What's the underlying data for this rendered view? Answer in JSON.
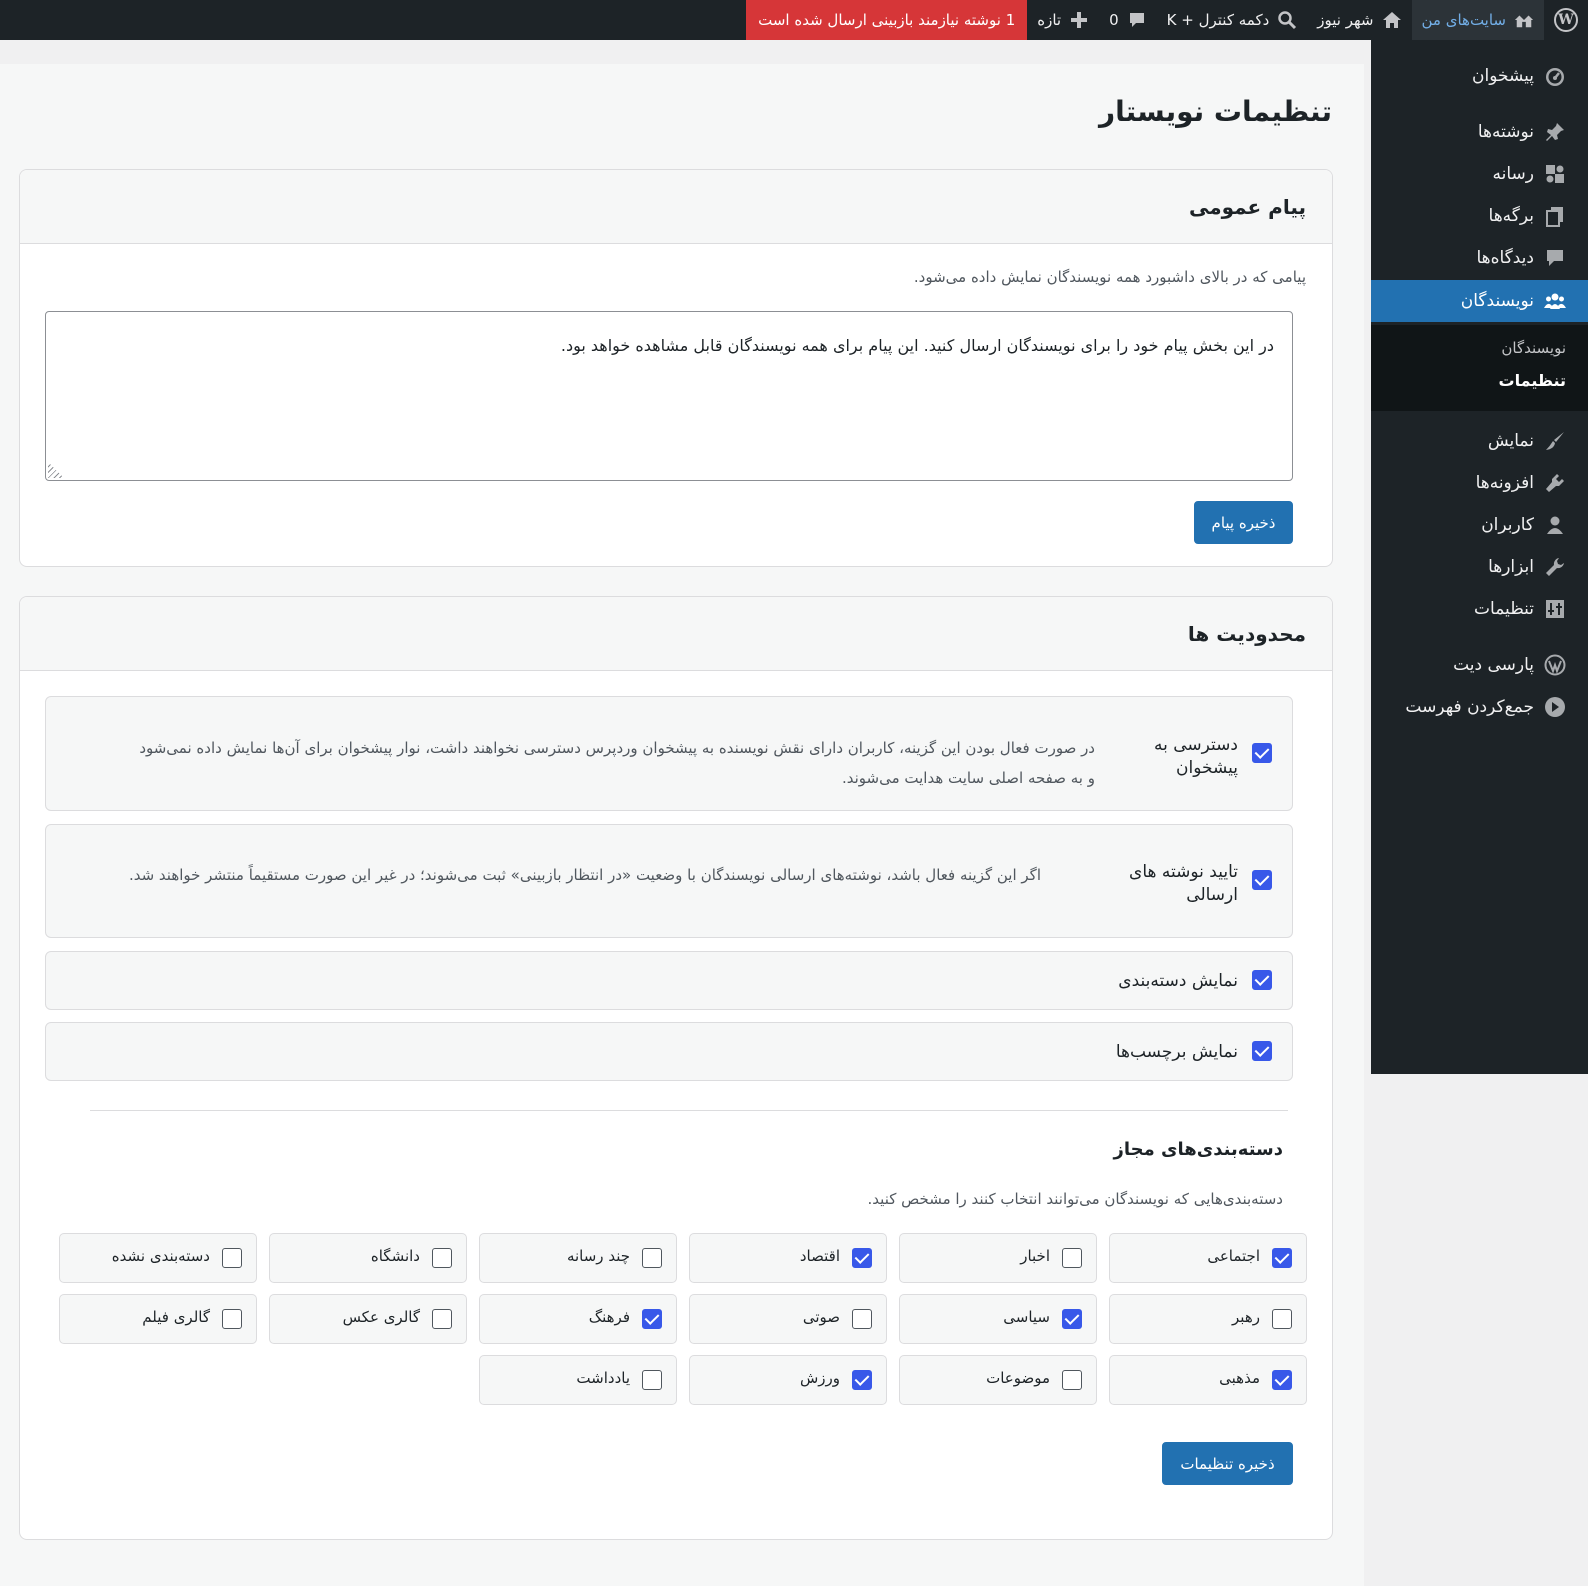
{
  "admin_bar": {
    "my_sites": "سایت‌های من",
    "site_name": "شهر نیوز",
    "command": "دکمه کنترل + K",
    "comments_count": "0",
    "new": "تازه",
    "pending_notice": "1 نوشته نیازمند بازبینی ارسال شده است"
  },
  "sidebar": {
    "items": [
      {
        "label": "پیشخوان",
        "icon": "dashboard-icon"
      },
      {
        "label": "نوشته‌ها",
        "icon": "pin-icon"
      },
      {
        "label": "رسانه",
        "icon": "media-icon"
      },
      {
        "label": "برگه‌ها",
        "icon": "pages-icon"
      },
      {
        "label": "دیدگاه‌ها",
        "icon": "comment-icon"
      },
      {
        "label": "نویسندگان",
        "icon": "groups-icon"
      },
      {
        "label": "نمایش",
        "icon": "brush-icon"
      },
      {
        "label": "افزونه‌ها",
        "icon": "plugin-icon"
      },
      {
        "label": "کاربران",
        "icon": "user-icon"
      },
      {
        "label": "ابزارها",
        "icon": "wrench-icon"
      },
      {
        "label": "تنظیمات",
        "icon": "settings-icon"
      },
      {
        "label": "پارسی دیت",
        "icon": "wordpress-icon"
      },
      {
        "label": "جمع‌کردن فهرست",
        "icon": "collapse-icon"
      }
    ],
    "submenu": [
      "نویسندگان",
      "تنظیمات"
    ]
  },
  "page": {
    "title": "تنظیمات نویستار"
  },
  "public_message": {
    "heading": "پیام عمومی",
    "description": "پیامی که در بالای داشبورد همه نویسندگان نمایش داده می‌شود.",
    "textarea_value": "در این بخش پیام خود را برای نویسندگان ارسال کنید. این پیام برای همه نویسندگان قابل مشاهده خواهد بود.",
    "save_label": "ذخیره پیام"
  },
  "restrictions": {
    "heading": "محدودیت ها",
    "options": [
      {
        "label": "دسترسی به پیشخوان",
        "checked": true,
        "description": "در صورت فعال بودن این گزینه، کاربران دارای نقش نویسنده به پیشخوان وردپرس دسترسی نخواهند داشت، نوار پیشخوان برای آن‌ها نمایش داده نمی‌شود و به صفحه اصلی سایت هدایت می‌شوند."
      },
      {
        "label": "تایید نوشته های ارسالی",
        "checked": true,
        "description": "اگر این گزینه فعال باشد، نوشته‌های ارسالی نویسندگان با وضعیت «در انتظار بازبینی» ثبت می‌شوند؛ در غیر این صورت مستقیماً منتشر خواهند شد."
      },
      {
        "label": "نمایش دسته‌بندی",
        "checked": true
      },
      {
        "label": "نمایش برچسب‌ها",
        "checked": true
      }
    ],
    "categories_heading": "دسته‌بندی‌های مجاز",
    "categories_description": "دسته‌بندی‌هایی که نویسندگان می‌توانند انتخاب کنند را مشخص کنید.",
    "categories": [
      {
        "label": "اجتماعی",
        "checked": true
      },
      {
        "label": "اخبار",
        "checked": false
      },
      {
        "label": "اقتصاد",
        "checked": true
      },
      {
        "label": "چند رسانه",
        "checked": false
      },
      {
        "label": "دانشگاه",
        "checked": false
      },
      {
        "label": "دسته‌بندی نشده",
        "checked": false
      },
      {
        "label": "رهبر",
        "checked": false
      },
      {
        "label": "سیاسی",
        "checked": true
      },
      {
        "label": "صوتی",
        "checked": false
      },
      {
        "label": "فرهنگ",
        "checked": true
      },
      {
        "label": "گالری عکس",
        "checked": false
      },
      {
        "label": "گالری فیلم",
        "checked": false
      },
      {
        "label": "مذهبی",
        "checked": true
      },
      {
        "label": "موضوعات",
        "checked": false
      },
      {
        "label": "ورزش",
        "checked": true
      },
      {
        "label": "یادداشت",
        "checked": false
      }
    ],
    "save_label": "ذخیره تنظیمات"
  },
  "colors": {
    "accent": "#2271b1",
    "checkbox": "#3858e9",
    "notice": "#d63638",
    "adminbar": "#1d2327"
  }
}
